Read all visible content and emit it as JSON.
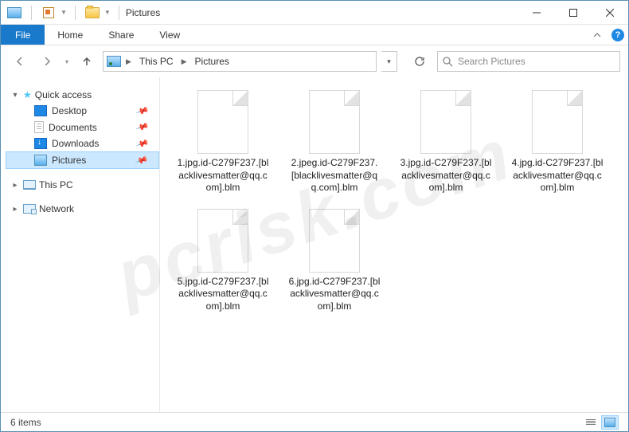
{
  "window": {
    "title": "Pictures"
  },
  "ribbon": {
    "file": "File",
    "tabs": [
      "Home",
      "Share",
      "View"
    ]
  },
  "breadcrumb": {
    "root": "This PC",
    "current": "Pictures"
  },
  "search": {
    "placeholder": "Search Pictures"
  },
  "sidebar": {
    "quick_access": {
      "label": "Quick access",
      "items": [
        {
          "label": "Desktop",
          "pinned": true
        },
        {
          "label": "Documents",
          "pinned": true
        },
        {
          "label": "Downloads",
          "pinned": true
        },
        {
          "label": "Pictures",
          "pinned": true,
          "selected": true
        }
      ]
    },
    "this_pc": {
      "label": "This PC"
    },
    "network": {
      "label": "Network"
    }
  },
  "files": [
    {
      "name": "1.jpg.id-C279F237.[blacklivesmatter@qq.com].blm"
    },
    {
      "name": "2.jpeg.id-C279F237.[blacklivesmatter@qq.com].blm"
    },
    {
      "name": "3.jpg.id-C279F237.[blacklivesmatter@qq.com].blm"
    },
    {
      "name": "4.jpg.id-C279F237.[blacklivesmatter@qq.com].blm"
    },
    {
      "name": "5.jpg.id-C279F237.[blacklivesmatter@qq.com].blm"
    },
    {
      "name": "6.jpg.id-C279F237.[blacklivesmatter@qq.com].blm"
    }
  ],
  "status": {
    "item_count": "6 items"
  },
  "watermark": "pcrisk.com"
}
